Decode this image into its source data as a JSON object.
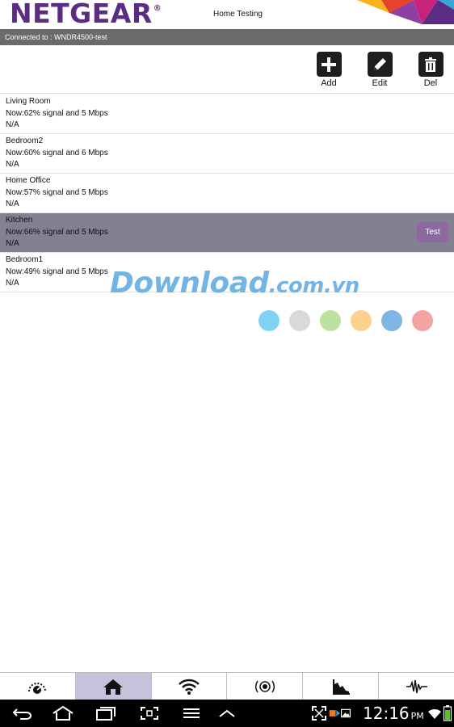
{
  "header": {
    "logo": "NETGEAR",
    "logo_mark": "®",
    "title": "Home Testing"
  },
  "connection": {
    "text": "Connected to : WNDR4500-test"
  },
  "toolbar": {
    "add": {
      "label": "Add",
      "icon": "plus-icon"
    },
    "edit": {
      "label": "Edit",
      "icon": "pencil-icon"
    },
    "del": {
      "label": "Del",
      "icon": "trash-icon"
    }
  },
  "locations": [
    {
      "name": "Living Room",
      "now": "Now:62% signal and 5 Mbps",
      "status": "N/A"
    },
    {
      "name": "Bedroom2",
      "now": "Now:60% signal and 6 Mbps",
      "status": "N/A"
    },
    {
      "name": "Home Office",
      "now": "Now:57% signal and 5 Mbps",
      "status": "N/A"
    },
    {
      "name": "Kitchen",
      "now": "Now:66% signal and 5 Mbps",
      "status": "N/A"
    },
    {
      "name": "Bedroom1",
      "now": "Now:49% signal and 5 Mbps",
      "status": "N/A"
    }
  ],
  "selected_location": "Kitchen",
  "test_button": {
    "label": "Test"
  },
  "watermark": {
    "main": "Download",
    "suffix": ".com.vn"
  },
  "watermark_dot_colors": [
    "#7fd3f5",
    "#d9d9d9",
    "#bde29f",
    "#fcd08f",
    "#7fb5e3",
    "#f4a3a3"
  ],
  "bottom_tabs": [
    {
      "name": "dashboard",
      "icon": "speedometer-icon"
    },
    {
      "name": "home",
      "icon": "home-icon",
      "active": true
    },
    {
      "name": "wifi",
      "icon": "wifi-icon"
    },
    {
      "name": "signal",
      "icon": "signal-target-icon"
    },
    {
      "name": "chart",
      "icon": "area-chart-icon"
    },
    {
      "name": "waveform",
      "icon": "waveform-icon"
    }
  ],
  "system_bar": {
    "time": "12:16",
    "ampm": "PM"
  },
  "colors": {
    "brand": "#5b2c83",
    "connection_bar": "#6b6b6b",
    "selected_row": "#828091",
    "test_button": "#8b6aa3",
    "active_tab": "#c7c1dc"
  }
}
